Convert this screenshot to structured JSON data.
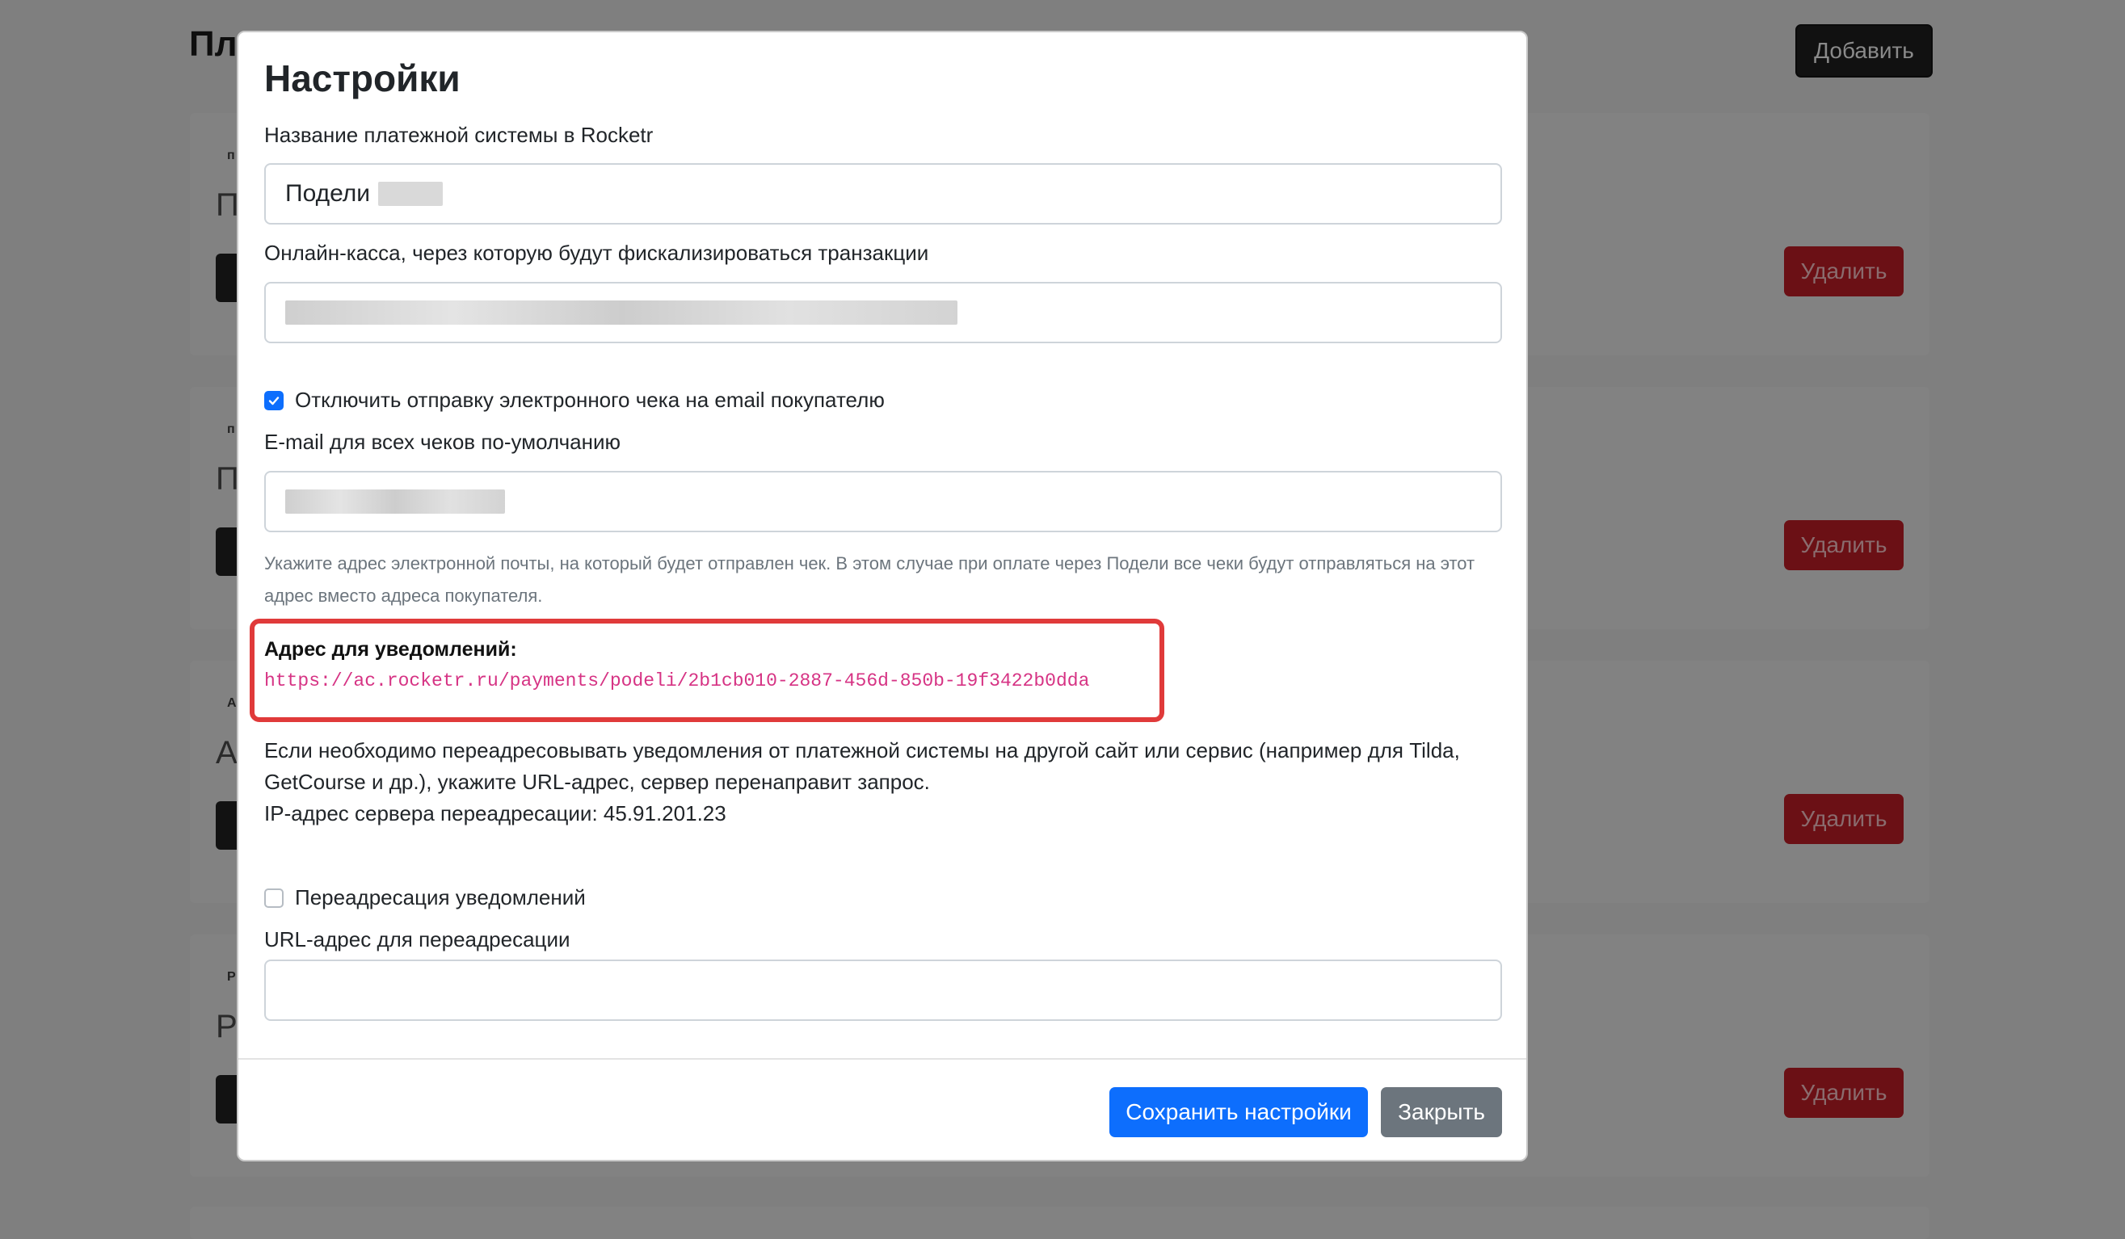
{
  "page": {
    "title": "Пл",
    "add_label": "Добавить",
    "delete_label": "Удалить",
    "cards": [
      {
        "letter": "П",
        "tiny": "п"
      },
      {
        "letter": "П",
        "tiny": "п"
      },
      {
        "letter": "А",
        "tiny": "А"
      },
      {
        "letter": "Р",
        "tiny": "Р"
      }
    ]
  },
  "modal": {
    "title": "Настройки",
    "name_label": "Название платежной системы в Rocketr",
    "name_value": "Подели",
    "kassa_label": "Онлайн-касса, через которую будут фискализироваться транзакции",
    "disable_receipt_label": "Отключить отправку электронного чека на email покупателю",
    "disable_receipt_checked": true,
    "email_label": "E-mail для всех чеков по-умолчанию",
    "email_help": "Укажите адрес электронной почты, на который будет отправлен чек. В этом случае при оплате через Подели все чеки будут отправляться на этот адрес вместо адреса покупателя.",
    "notify_label": "Адрес для уведомлений:",
    "notify_url": "https://ac.rocketr.ru/payments/podeli/2b1cb010-2887-456d-850b-19f3422b0dda",
    "redirect_info": "Если необходимо переадресовывать уведомления от платежной системы на другой сайт или сервис (например для Tilda, GetCourse и др.), укажите URL-адрес, сервер перенаправит запрос.",
    "redirect_ip": "IP-адрес сервера переадресации: 45.91.201.23",
    "redirect_label": "Переадресация уведомлений",
    "redirect_checked": false,
    "redirect_url_label": "URL-адрес для переадресации",
    "redirect_url_value": "",
    "save_label": "Сохранить настройки",
    "close_label": "Закрыть"
  },
  "colors": {
    "primary": "#0d6efd",
    "secondary": "#6c757d",
    "highlight": "#e03a3a",
    "code": "#d63384",
    "danger": "#dc3545"
  },
  "icons": {
    "check": "check-icon"
  }
}
